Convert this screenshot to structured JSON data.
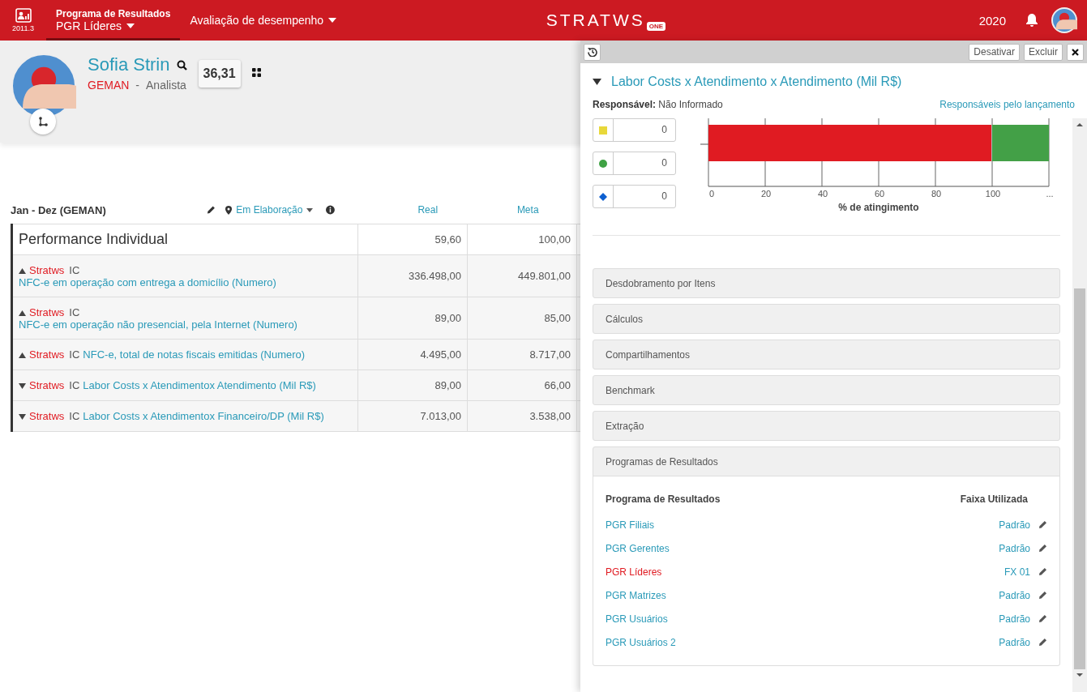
{
  "header": {
    "version": "2011.3",
    "nav": [
      {
        "title": "Programa de Resultados",
        "label": "PGR Líderes",
        "selected": true
      },
      {
        "label": "Avaliação de desempenho",
        "selected": false
      }
    ],
    "logo": {
      "text": "STRATWS",
      "badge": "ONE"
    },
    "year": "2020"
  },
  "profile": {
    "name": "Sofia Strin",
    "unit": "GEMAN",
    "separator": "-",
    "role": "Analista",
    "score": "36,31"
  },
  "period": {
    "label": "Jan - Dez (GEMAN)",
    "status": "Em Elaboração",
    "columns": [
      "Real",
      "Meta"
    ]
  },
  "rows": [
    {
      "kind": "group",
      "name": "Performance Individual",
      "real": "59,60",
      "meta": "100,00"
    },
    {
      "kind": "indicator",
      "rising": true,
      "source": "Stratws",
      "type": "IC",
      "name": "NFC-e em operação com entrega a domicílio (Numero)",
      "line_break": true,
      "real": "336.498,00",
      "meta": "449.801,00"
    },
    {
      "kind": "indicator",
      "rising": true,
      "source": "Stratws",
      "type": "IC",
      "name": "NFC-e em operação não presencial, pela Internet (Numero)",
      "line_break": true,
      "real": "89,00",
      "meta": "85,00"
    },
    {
      "kind": "indicator",
      "rising": true,
      "source": "Stratws",
      "type": "IC",
      "name": "NFC-e, total de notas fiscais emitidas (Numero)",
      "line_break": false,
      "real": "4.495,00",
      "meta": "8.717,00"
    },
    {
      "kind": "indicator",
      "rising": false,
      "source": "Stratws",
      "type": "IC",
      "name": "Labor Costs x Atendimentox Atendimento (Mil R$)",
      "line_break": false,
      "real": "89,00",
      "meta": "66,00"
    },
    {
      "kind": "indicator",
      "rising": false,
      "source": "Stratws",
      "type": "IC",
      "name": "Labor Costs x Atendimentox Financeiro/DP (Mil R$)",
      "line_break": false,
      "real": "7.013,00",
      "meta": "3.538,00"
    }
  ],
  "panel": {
    "buttons": [
      "Desativar",
      "Excluir"
    ],
    "title": "Labor Costs x Atendimento x Atendimento (Mil R$)",
    "expanded": true,
    "responsible_label": "Responsável:",
    "responsible": "Não Informado",
    "responsible_link": "Responsáveis pelo lançamento",
    "legend": [
      {
        "kind": "square",
        "color": "#e8d83a",
        "value": "0"
      },
      {
        "kind": "circle",
        "color": "#3fa244",
        "value": "0"
      },
      {
        "kind": "diamond",
        "color": "#0d5fd0",
        "value": "0"
      }
    ],
    "chart_data": {
      "type": "bar",
      "orientation": "horizontal",
      "stacked": true,
      "xlabel": "% de atingimento",
      "categories": [
        null
      ],
      "grid": true,
      "xlim": [
        0,
        120
      ],
      "xticks": [
        0,
        20,
        40,
        60,
        80,
        100,
        {
          "value": 120,
          "label": "..."
        }
      ],
      "series": [
        {
          "color": "#e01b22",
          "values": [
            100
          ]
        },
        {
          "color": "#43a047",
          "values": [
            20
          ]
        }
      ]
    },
    "sections": [
      {
        "title": "Desdobramento por Itens",
        "expanded": false
      },
      {
        "title": "Cálculos",
        "expanded": false
      },
      {
        "title": "Compartilhamentos",
        "expanded": false
      },
      {
        "title": "Benchmark",
        "expanded": false
      },
      {
        "title": "Extração",
        "expanded": false
      },
      {
        "title": "Programas de Resultados",
        "expanded": true
      }
    ],
    "programs": {
      "columns": [
        "Programa de Resultados",
        "Faixa Utilizada"
      ],
      "rows": [
        {
          "program": "PGR Filiais",
          "band": "Padrão",
          "selected": false
        },
        {
          "program": "PGR Gerentes",
          "band": "Padrão",
          "selected": false
        },
        {
          "program": "PGR Líderes",
          "band": "FX 01",
          "selected": true
        },
        {
          "program": "PGR Matrizes",
          "band": "Padrão",
          "selected": false
        },
        {
          "program": "PGR Usuários",
          "band": "Padrão",
          "selected": false
        },
        {
          "program": "PGR Usuários 2",
          "band": "Padrão",
          "selected": false
        }
      ]
    }
  }
}
